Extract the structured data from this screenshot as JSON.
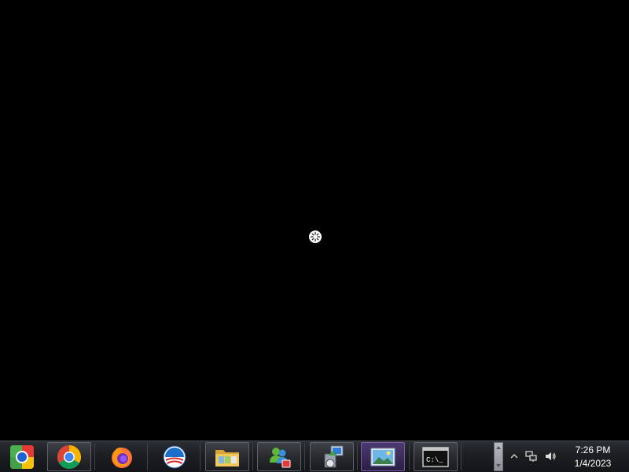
{
  "desktop": {
    "background": "#000000",
    "cursor": "busy-loading-icon"
  },
  "taskbar": {
    "items": [
      {
        "name": "chrome-canary-icon",
        "running": false
      },
      {
        "name": "chrome-icon",
        "running": true
      },
      {
        "name": "firefox-icon",
        "running": false
      },
      {
        "name": "campaign-logo-icon",
        "running": false
      },
      {
        "name": "file-explorer-icon",
        "running": true
      },
      {
        "name": "messenger-icon",
        "running": true
      },
      {
        "name": "installer-icon",
        "running": true
      },
      {
        "name": "photo-viewer-icon",
        "running": true,
        "active": true
      },
      {
        "name": "command-prompt-icon",
        "running": true
      }
    ],
    "cmd_label": "C:\\_"
  },
  "tray": {
    "show_hidden": "show-hidden-icons-icon",
    "network": "network-icon",
    "volume": "volume-icon"
  },
  "clock": {
    "time": "7:26 PM",
    "date": "1/4/2023"
  }
}
